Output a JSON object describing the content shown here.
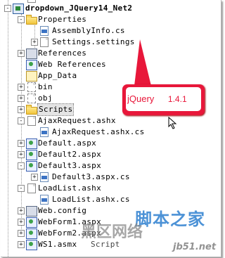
{
  "tree": [
    {
      "label": "dropdown_JQuery14_Net2",
      "icon": "project-icon",
      "expander": "",
      "bold": true
    },
    {
      "label": "Properties",
      "icon": "folder-icon",
      "expander": "-"
    },
    {
      "label": "AssemblyInfo.cs",
      "icon": "cs-file-icon",
      "expander": ""
    },
    {
      "label": "Settings.settings",
      "icon": "settings-file-icon",
      "expander": "+"
    },
    {
      "label": "References",
      "icon": "references-icon",
      "expander": "+"
    },
    {
      "label": "Web References",
      "icon": "web-references-icon",
      "expander": ""
    },
    {
      "label": "App_Data",
      "icon": "app-data-folder-icon",
      "expander": ""
    },
    {
      "label": "bin",
      "icon": "folder-icon",
      "expander": "+"
    },
    {
      "label": "obj",
      "icon": "folder-icon",
      "expander": "+"
    },
    {
      "label": "Scripts",
      "icon": "folder-icon",
      "expander": "+",
      "selected": true
    },
    {
      "label": "AjaxRequest.ashx",
      "icon": "ashx-file-icon",
      "expander": "-"
    },
    {
      "label": "AjaxRequest.ashx.cs",
      "icon": "cs-file-icon",
      "expander": ""
    },
    {
      "label": "Default.aspx",
      "icon": "aspx-file-icon",
      "expander": "+"
    },
    {
      "label": "Default2.aspx",
      "icon": "aspx-file-icon",
      "expander": "+"
    },
    {
      "label": "Default3.aspx",
      "icon": "aspx-file-icon",
      "expander": "-"
    },
    {
      "label": "Default3.aspx.cs",
      "icon": "cs-file-icon",
      "expander": "+"
    },
    {
      "label": "LoadList.ashx",
      "icon": "ashx-file-icon",
      "expander": "-"
    },
    {
      "label": "LoadList.ashx.cs",
      "icon": "cs-file-icon",
      "expander": ""
    },
    {
      "label": "Web.config",
      "icon": "config-file-icon",
      "expander": "+"
    },
    {
      "label": "WebForm1.aspx",
      "icon": "aspx-file-icon",
      "expander": "+"
    },
    {
      "label": "WebForm2.aspx",
      "icon": "aspx-file-icon",
      "expander": "+"
    },
    {
      "label": "WS1.asmx",
      "icon": "asmx-file-icon",
      "expander": "+"
    }
  ],
  "callout": {
    "label": "jQuery",
    "version": "1.4.1",
    "color": "#e8173a"
  },
  "tooltip_fragment": "Script",
  "watermark": {
    "cn": "脚本之家",
    "cn2": "黑区网络",
    "site": "jb51.net"
  }
}
